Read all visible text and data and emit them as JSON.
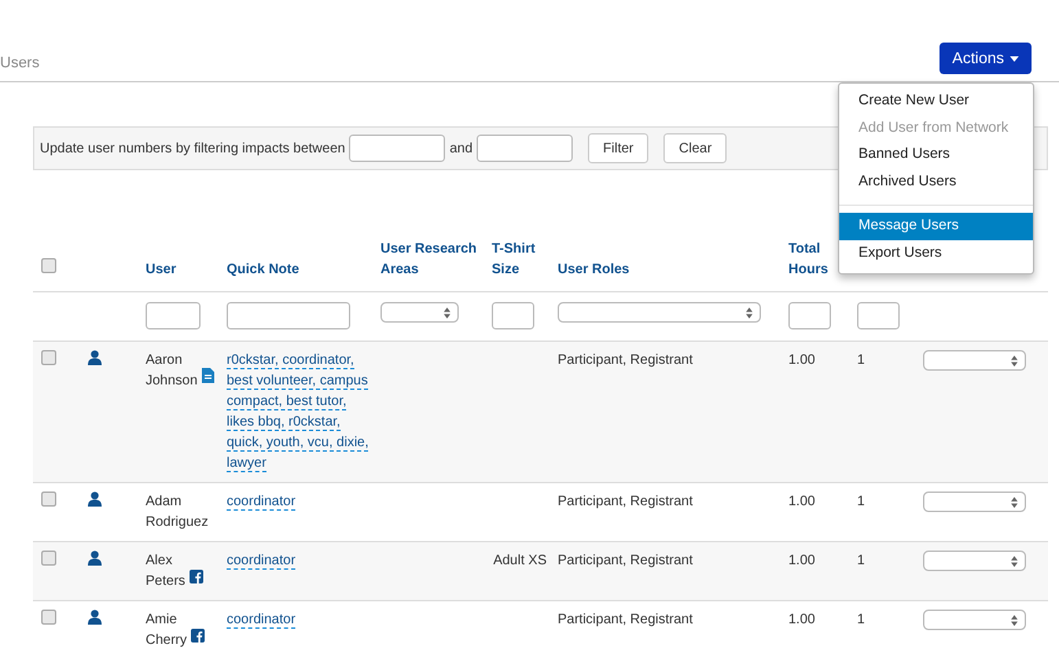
{
  "breadcrumb": "Users",
  "actions_button": {
    "label": "Actions",
    "expanded": true
  },
  "actions_menu": [
    {
      "kind": "item",
      "label": "Create New User",
      "disabled": false,
      "selected": false
    },
    {
      "kind": "item",
      "label": "Add User from Network",
      "disabled": true,
      "selected": false
    },
    {
      "kind": "item",
      "label": "Banned Users",
      "disabled": false,
      "selected": false
    },
    {
      "kind": "item",
      "label": "Archived Users",
      "disabled": false,
      "selected": false
    },
    {
      "kind": "divider"
    },
    {
      "kind": "item",
      "label": "Message Users",
      "disabled": false,
      "selected": true
    },
    {
      "kind": "item",
      "label": "Export Users",
      "disabled": false,
      "selected": false
    }
  ],
  "filter_bar": {
    "text": "Update user numbers by filtering impacts between",
    "and": "and",
    "buttons": [
      "Filter",
      "Clear"
    ]
  },
  "table": {
    "columns": [
      {
        "kind": "checkbox"
      },
      {
        "kind": "none"
      },
      {
        "label": "User",
        "kind": "text"
      },
      {
        "label": "Quick Note",
        "kind": "value"
      },
      {
        "label": "User Research Areas",
        "kind": "select"
      },
      {
        "label": "T-Shirt Size",
        "kind": "text"
      },
      {
        "label": "User Roles",
        "kind": "select"
      },
      {
        "label": "Total Hours",
        "kind": "text"
      },
      {
        "kind": "text"
      },
      {
        "kind": "none"
      }
    ],
    "header_checked": false,
    "rows": [
      {
        "checked": false,
        "user": "Aaron Johnson",
        "user_icon": {
          "kind": "document"
        },
        "quick_note": "r0ckstar, coordinator, best volunteer, campus compact, best tutor, likes bbq, r0ckstar, quick, youth, vcu, dixie, lawyer",
        "roles": "Participant, Registrant",
        "hours": "1.00",
        "impacts": "1"
      },
      {
        "checked": false,
        "user": "Adam Rodriguez",
        "quick_note": "coordinator",
        "roles": "Participant, Registrant",
        "hours": "1.00",
        "impacts": "1"
      },
      {
        "checked": false,
        "user": "Alex Peters",
        "user_icon": {
          "kind": "facebook"
        },
        "quick_note": "coordinator",
        "tshirt": "Adult XS",
        "roles": "Participant, Registrant",
        "hours": "1.00",
        "impacts": "1"
      },
      {
        "checked": false,
        "user": "Amie Cherry",
        "user_icon": {
          "kind": "facebook"
        },
        "quick_note": "coordinator",
        "roles": "Participant, Registrant",
        "hours": "1.00",
        "impacts": "1"
      }
    ]
  }
}
